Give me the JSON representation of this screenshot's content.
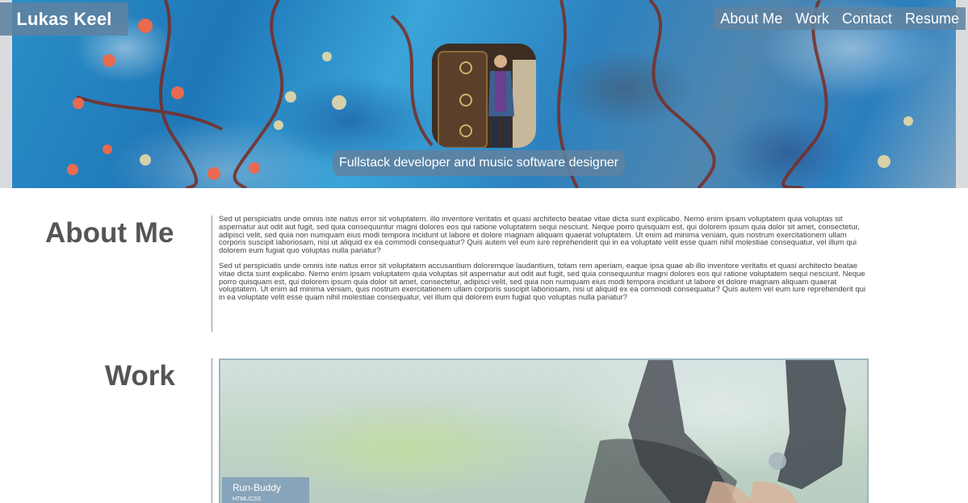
{
  "header": {
    "logo": "Lukas Keel",
    "nav": [
      "About Me",
      "Work",
      "Contact",
      "Resume"
    ],
    "tagline": "Fullstack developer and music software designer"
  },
  "about": {
    "title": "About Me",
    "paragraphs": [
      "Sed ut perspiciatis unde omnis iste natus error sit voluptatem. illo inventore veritatis et quasi architecto beatae vitae dicta sunt explicabo. Nemo enim ipsam voluptatem quia voluptas sit aspernatur aut odit aut fugit, sed quia consequuntur magni dolores eos qui ratione voluptatem sequi nesciunt. Neque porro quisquam est, qui dolorem ipsum quia dolor sit amet, consectetur, adipisci velit, sed quia non numquam eius modi tempora incidunt ut labore et dolore magnam aliquam quaerat voluptatem. Ut enim ad minima veniam, quis nostrum exercitationem ullam corporis suscipit laboriosam, nisi ut aliquid ex ea commodi consequatur? Quis autem vel eum iure reprehenderit qui in ea voluptate velit esse quam nihil molestiae consequatur, vel illum qui dolorem eum fugiat quo voluptas nulla pariatur?",
      "Sed ut perspiciatis unde omnis iste natus error sit voluptatem accusantium doloremque laudantium, totam rem aperiam, eaque ipsa quae ab illo inventore veritatis et quasi architecto beatae vitae dicta sunt explicabo. Nemo enim ipsam voluptatem quia voluptas sit aspernatur aut odit aut fugit, sed quia consequuntur magni dolores eos qui ratione voluptatem sequi nesciunt. Neque porro quisquam est, qui dolorem ipsum quia dolor sit amet, consectetur, adipisci velit, sed quia non numquam eius modi tempora incidunt ut labore et dolore magnam aliquam quaerat voluptatem. Ut enim ad minima veniam, quis nostrum exercitationem ullam corporis suscipit laboriosam, nisi ut aliquid ex ea commodi consequatur? Quis autem vel eum iure reprehenderit qui in ea voluptate velit esse quam nihil molestiae consequatur, vel illum qui dolorem eum fugiat quo voluptas nulla pariatur?"
    ]
  },
  "work": {
    "title": "Work",
    "projects": [
      {
        "title": "Run-Buddy",
        "tech": "HTML/CSS"
      }
    ]
  },
  "colors": {
    "accent": "#5f82a0",
    "heading": "#555555",
    "divider": "#7e94a4"
  }
}
